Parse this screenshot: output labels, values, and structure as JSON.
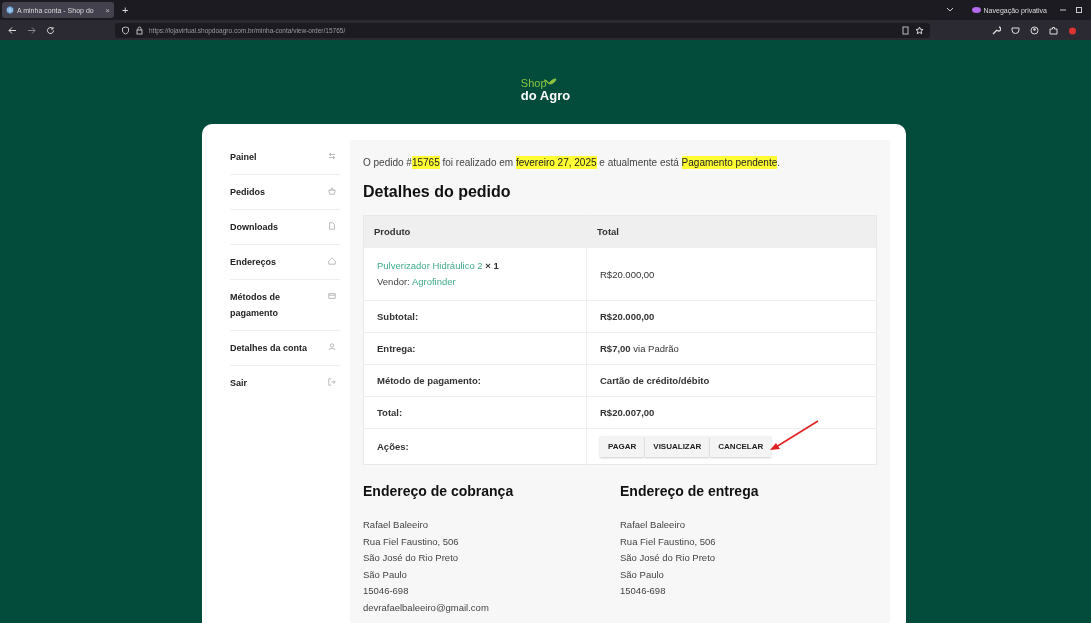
{
  "browser": {
    "tab": {
      "title": "A minha conta - Shop do",
      "close": "×",
      "selected": true
    },
    "new_tab": "+",
    "private_label": "Navegação privativa",
    "url": "https://lojavirtual.shopdoagro.com.br/minha-conta/view-order/15765/"
  },
  "logo": {
    "line1": "Shop",
    "line2": "do Agro"
  },
  "sidebar": {
    "items": [
      {
        "label": "Painel"
      },
      {
        "label": "Pedidos"
      },
      {
        "label": "Downloads"
      },
      {
        "label": "Endereços"
      },
      {
        "label": "Métodos de pagamento"
      },
      {
        "label": "Detalhes da conta"
      },
      {
        "label": "Sair"
      }
    ]
  },
  "order": {
    "sentence": [
      {
        "text": "O pedido #",
        "highlighted": false
      },
      {
        "text": "15765",
        "highlighted": true
      },
      {
        "text": " foi realizado em ",
        "highlighted": false
      },
      {
        "text": "fevereiro 27, 2025",
        "highlighted": true
      },
      {
        "text": " e atualmente está ",
        "highlighted": false
      },
      {
        "text": "Pagamento pendente",
        "highlighted": true
      },
      {
        "text": ".",
        "highlighted": false
      }
    ],
    "heading": "Detalhes do pedido",
    "table": {
      "columns": [
        "Produto",
        "Total"
      ],
      "product": {
        "name": "Pulverizador Hidráulico 2",
        "quantity": "× 1",
        "vendor_label": "Vendor:",
        "vendor": "Agrofinder",
        "total": "R$20.000,00"
      },
      "rows": [
        {
          "label": "Subtotal:",
          "value": "**R$20.000,00**"
        },
        {
          "label": "Entrega:",
          "value": "**R$7,00** via Padrão"
        },
        {
          "label": "Método de pagamento:",
          "value": "**Cartão de crédito/débito**"
        },
        {
          "label": "Total:",
          "value": "**R$20.007,00**"
        }
      ],
      "actions": {
        "label": "Ações:",
        "buttons": [
          "PAGAR",
          "VISUALIZAR",
          "CANCELAR"
        ]
      }
    }
  },
  "addresses": [
    {
      "heading": "Endereço de cobrança",
      "lines": [
        "Rafael Baleeiro",
        "Rua Fiel Faustino, 506",
        "São José do Rio Preto",
        "São Paulo",
        "15046-698",
        "devrafaelbaleeiro@gmail.com"
      ]
    },
    {
      "heading": "Endereço de entrega",
      "lines": [
        "Rafael Baleeiro",
        "Rua Fiel Faustino, 506",
        "São José do Rio Preto",
        "São Paulo",
        "15046-698"
      ]
    }
  ]
}
